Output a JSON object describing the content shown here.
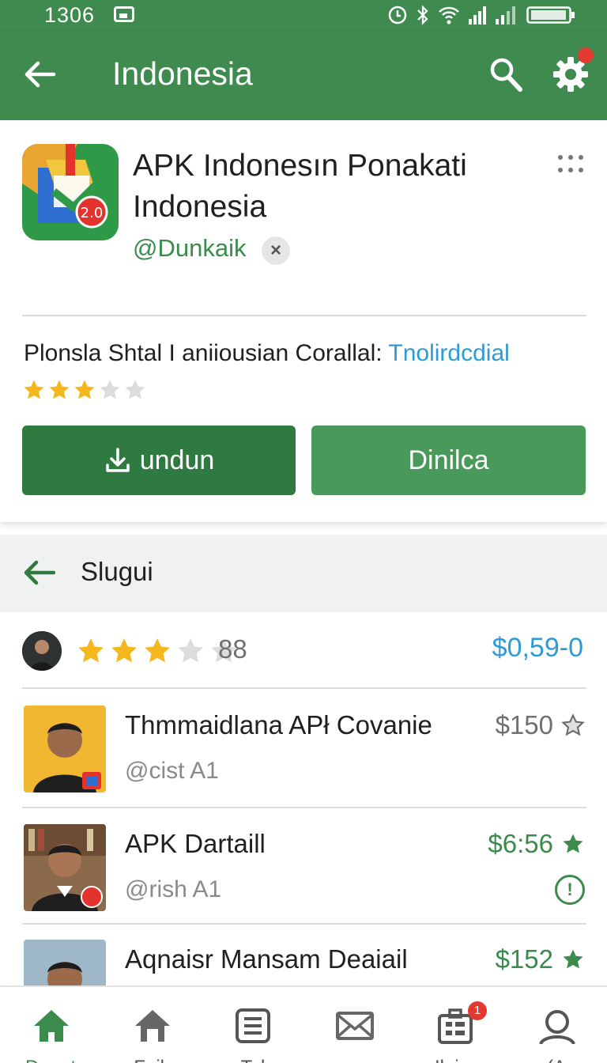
{
  "status_bar": {
    "time": "1306",
    "icons": [
      "photo-icon",
      "alarm-icon",
      "bluetooth-icon",
      "wifi-icon",
      "signal-icon",
      "signal-icon",
      "battery-icon"
    ]
  },
  "app_bar": {
    "title": "Indonesia",
    "color": "#3f8a4f"
  },
  "app_detail": {
    "name_line1": "APK Indonesın Ponakati",
    "name_line2": "Indonesia",
    "developer": "@Dunkaik",
    "icon_badge": "2.0",
    "description": "Plonsla Shtal I aniiousian Corallal: ",
    "description_link": "Tnolirdcdial",
    "rating": 3,
    "rating_max": 5,
    "primary_button": "undun",
    "secondary_button": "Dinilca"
  },
  "section": {
    "label": "Slugui"
  },
  "summary": {
    "rating": 3,
    "rating_max": 5,
    "count": "88",
    "price": "$0,59-0"
  },
  "items": [
    {
      "name": "Thmmaidlana APł Covanie",
      "handle": "@cist A1",
      "price": "$150",
      "price_color": "#707070"
    },
    {
      "name": "APK Dartaill",
      "handle": "@rish A1",
      "price": "$6:56",
      "price_color": "#3b8b4c",
      "info": "!"
    },
    {
      "name": "Aqnaisr Mansam Deaiail",
      "handle": "",
      "price": "$152",
      "price_color": "#3b8b4c"
    }
  ],
  "bottom_nav": {
    "items": [
      {
        "label": "Dount",
        "icon": "home-icon"
      },
      {
        "label": "Faik",
        "icon": "home-outline-icon"
      },
      {
        "label": "Tal",
        "icon": "list-icon"
      },
      {
        "label": "",
        "icon": "mail-icon"
      },
      {
        "label": "Ilaira",
        "icon": "briefcase-icon",
        "badge": "1"
      },
      {
        "label": "(A",
        "icon": "profile-icon"
      }
    ]
  }
}
